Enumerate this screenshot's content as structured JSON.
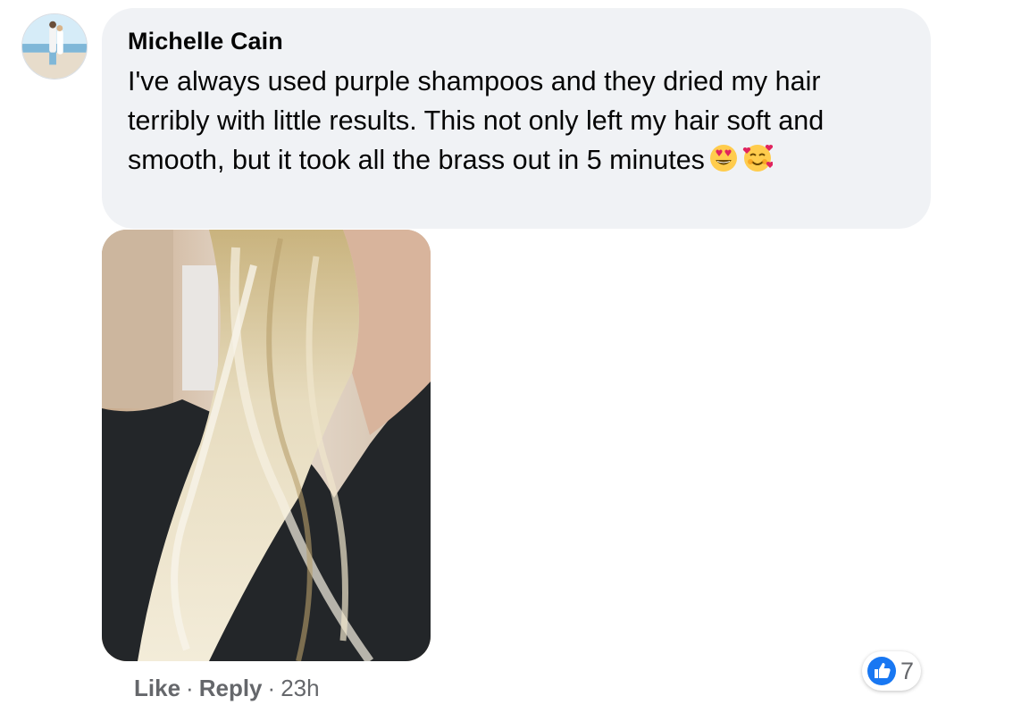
{
  "comment": {
    "author": "Michelle Cain",
    "text": "I've always used purple shampoos and they dried my hair terribly with little results. This not only left my hair soft and smooth, but it took all the brass out in 5 minutes",
    "emojis": [
      "smiling-face-with-heart-eyes-icon",
      "smiling-face-with-hearts-icon"
    ]
  },
  "actions": {
    "like_label": "Like",
    "separator": "·",
    "reply_label": "Reply",
    "timestamp": "23h"
  },
  "reactions": {
    "icon": "thumbs-up-icon",
    "count": "7",
    "color": "#1877f2"
  }
}
